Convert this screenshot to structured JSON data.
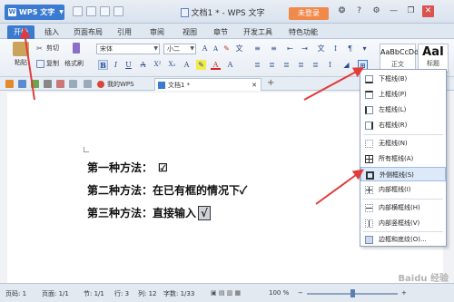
{
  "app": {
    "name": "WPS 文字",
    "doc_title": "文档1 * - WPS 文字",
    "login_label": "未登录"
  },
  "tabs": [
    {
      "label": "开始"
    },
    {
      "label": "插入"
    },
    {
      "label": "页面布局"
    },
    {
      "label": "引用"
    },
    {
      "label": "审阅"
    },
    {
      "label": "视图"
    },
    {
      "label": "章节"
    },
    {
      "label": "开发工具"
    },
    {
      "label": "特色功能"
    }
  ],
  "ribbon": {
    "paste_label": "粘贴",
    "cut_label": "剪切",
    "copy_label": "复制",
    "format_painter_label": "格式刷",
    "font_name": "宋体",
    "font_size": "小二",
    "style_normal_sample": "AaBbCcDd",
    "style_normal_label": "正文",
    "style_title_sample": "AaI",
    "style_title_label": "标题"
  },
  "doc_tabs": [
    {
      "label": "我的WPS"
    },
    {
      "label": "文档1 *"
    }
  ],
  "document": {
    "line1_label": "第一种方法：",
    "line1_mark": "☑",
    "line2_label": "第二种方法：在已有框的情况下",
    "line2_mark": "✓",
    "line3_label": "第三种方法：直接输入",
    "line3_mark": "√"
  },
  "border_menu": {
    "items": [
      "下框线(B)",
      "上框线(P)",
      "左框线(L)",
      "右框线(R)",
      "无框线(N)",
      "所有框线(A)",
      "外侧框线(S)",
      "内部框线(I)",
      "内部横框线(H)",
      "内部竖框线(V)",
      "边框和底纹(O)..."
    ],
    "highlighted_index": 6
  },
  "statusbar": {
    "page": "页码: 1",
    "pages": "页面: 1/1",
    "section": "节: 1/1",
    "row": "行: 3",
    "col": "列: 12",
    "words": "字数: 1/33",
    "zoom": "100 %"
  },
  "watermark": "Baidu 经验",
  "colors": {
    "accent": "#3b7ad1",
    "login": "#f08a4b",
    "arrow": "#e23b3b"
  }
}
